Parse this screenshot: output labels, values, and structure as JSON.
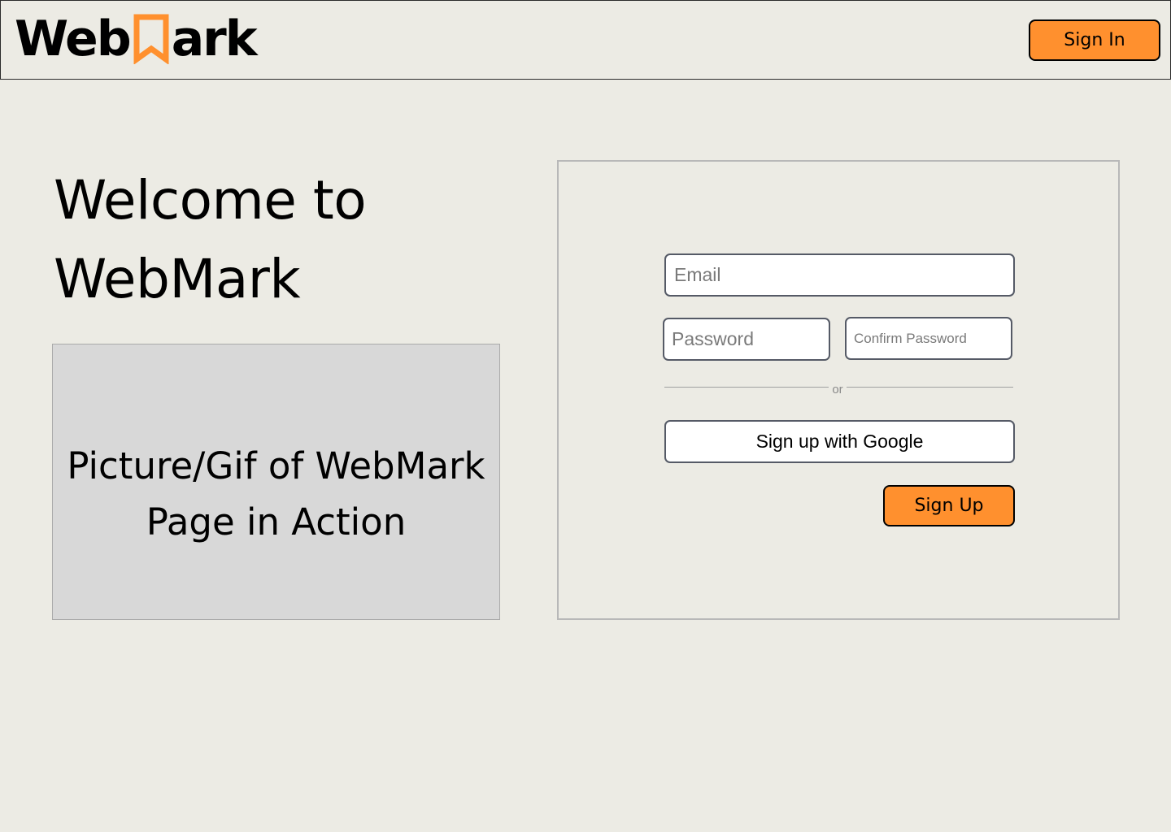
{
  "header": {
    "logo": {
      "text_before": "Web",
      "text_after": "ark",
      "icon": "bookmark-icon",
      "icon_color": "#ff902e"
    },
    "sign_in_label": "Sign In"
  },
  "welcome": {
    "line1": "Welcome to",
    "line2": "WebMark"
  },
  "preview": {
    "line1": "Picture/Gif of WebMark",
    "line2": "Page in Action"
  },
  "signup_form": {
    "email_placeholder": "Email",
    "password_placeholder": "Password",
    "confirm_password_placeholder": "Confirm Password",
    "divider_text": "or",
    "google_button_label": "Sign up with Google",
    "sign_up_label": "Sign Up"
  },
  "colors": {
    "background": "#ecebe4",
    "accent": "#ff902e",
    "placeholder_box": "#d8d8d8"
  }
}
